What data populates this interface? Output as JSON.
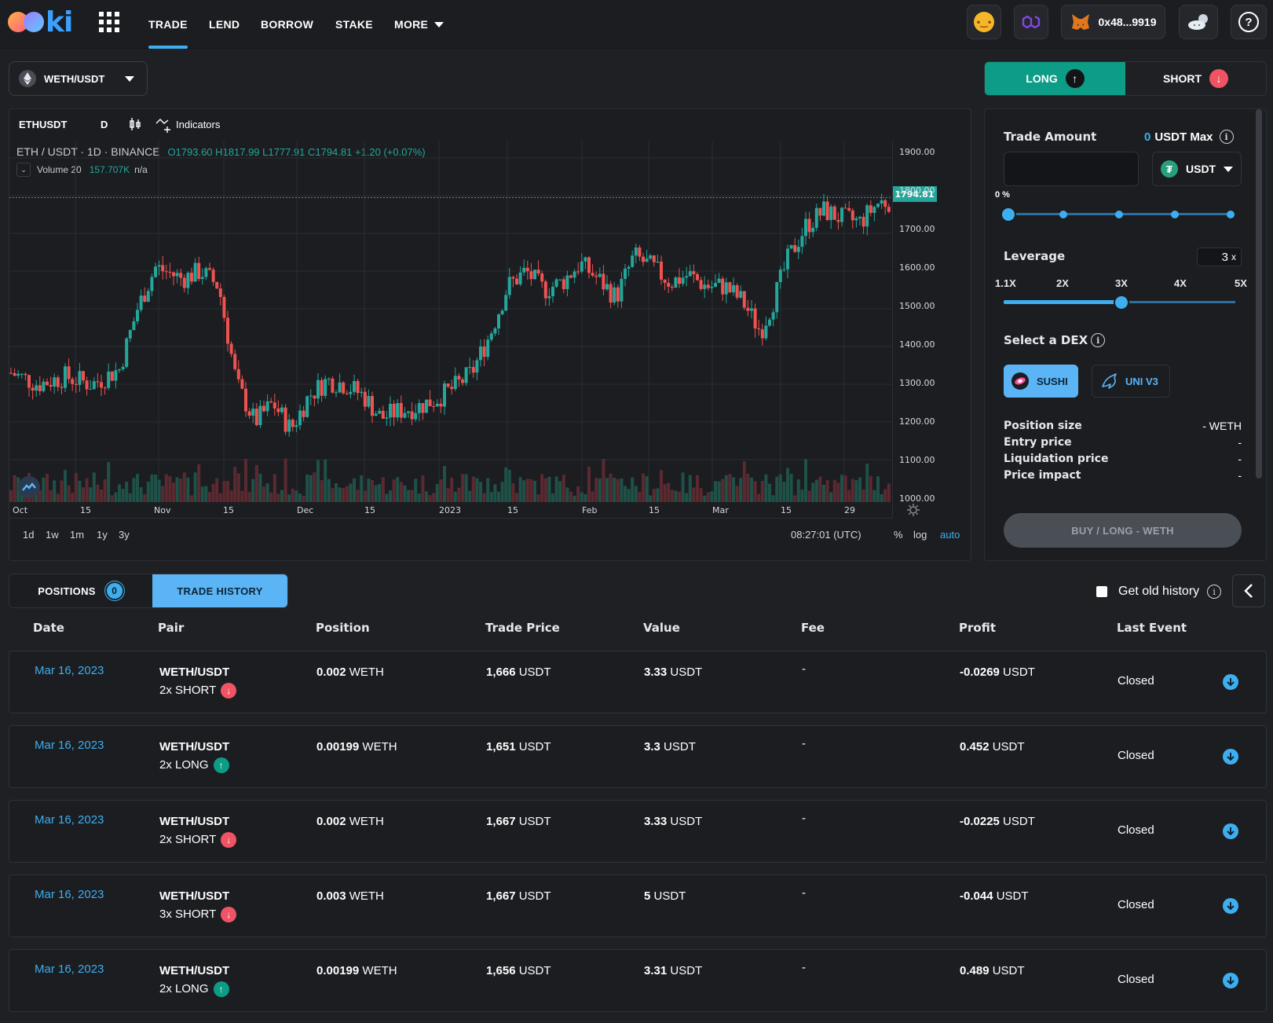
{
  "header": {
    "nav": [
      {
        "label": "TRADE",
        "active": true
      },
      {
        "label": "LEND",
        "active": false
      },
      {
        "label": "BORROW",
        "active": false
      },
      {
        "label": "STAKE",
        "active": false
      },
      {
        "label": "MORE",
        "active": false
      }
    ],
    "wallet_address": "0x48...9919"
  },
  "pair_selector": {
    "label": "WETH/USDT"
  },
  "chart": {
    "symbol": "ETHUSDT",
    "interval": "D",
    "indicators_label": "Indicators",
    "legend_title": "ETH / USDT · 1D · BINANCE",
    "ohlc": "O1793.60 H1817.99 L1777.91 C1794.81 +1.20 (+0.07%)",
    "volume_label": "Volume 20",
    "volume_value": "157.707K",
    "volume_na": "n/a",
    "last_price": "1794.81",
    "price_ticks": [
      "1900.00",
      "1800.00",
      "1700.00",
      "1600.00",
      "1500.00",
      "1400.00",
      "1300.00",
      "1200.00",
      "1100.00",
      "1000.00"
    ],
    "time_ticks": [
      "Oct",
      "15",
      "Nov",
      "15",
      "Dec",
      "15",
      "2023",
      "15",
      "Feb",
      "15",
      "Mar",
      "15",
      "29"
    ],
    "ranges": [
      "1d",
      "1w",
      "1m",
      "1y",
      "3y"
    ],
    "clock": "08:27:01 (UTC)",
    "percent_label": "%",
    "log_label": "log",
    "auto_label": "auto"
  },
  "chart_data": {
    "type": "candlestick",
    "ylim": [
      1000,
      1900
    ],
    "x_range": "Oct 2022 – Apr 2023",
    "last_close": 1794.81,
    "colors": {
      "up": "#26a69a",
      "down": "#ef5350"
    }
  },
  "side": {
    "long_label": "LONG",
    "short_label": "SHORT",
    "trade_amount_label": "Trade Amount",
    "max_value": "0",
    "max_text": "USDT Max",
    "token": "USDT",
    "percent": "0 %",
    "percent_fraction": 0,
    "leverage_label": "Leverage",
    "leverage_value": "3",
    "leverage_unit": "x",
    "leverage_steps": [
      "1.1X",
      "2X",
      "3X",
      "4X",
      "5X"
    ],
    "leverage_selected_fraction": 0.5,
    "dex_label": "Select a DEX",
    "dex_options": [
      "SUSHI",
      "UNI V3"
    ],
    "summary": [
      {
        "label": "Position size",
        "value": "- WETH"
      },
      {
        "label": "Entry price",
        "value": "-"
      },
      {
        "label": "Liquidation price",
        "value": "-"
      },
      {
        "label": "Price impact",
        "value": "-"
      }
    ],
    "buy_label": "BUY / LONG - WETH"
  },
  "bottom": {
    "positions_label": "POSITIONS",
    "positions_count": "0",
    "history_label": "TRADE HISTORY",
    "old_history_label": "Get old history"
  },
  "table": {
    "headers": [
      "Date",
      "Pair",
      "Position",
      "Trade Price",
      "Value",
      "Fee",
      "Profit",
      "Last Event"
    ],
    "rows": [
      {
        "date": "Mar 16, 2023",
        "pair": "WETH/USDT",
        "side": "2x SHORT",
        "dir": "short",
        "position": "0.002",
        "pos_unit": "WETH",
        "price": "1,666",
        "price_unit": "USDT",
        "value": "3.33",
        "value_unit": "USDT",
        "fee": "-",
        "profit": "-0.0269",
        "profit_unit": "USDT",
        "event": "Closed"
      },
      {
        "date": "Mar 16, 2023",
        "pair": "WETH/USDT",
        "side": "2x LONG",
        "dir": "long",
        "position": "0.00199",
        "pos_unit": "WETH",
        "price": "1,651",
        "price_unit": "USDT",
        "value": "3.3",
        "value_unit": "USDT",
        "fee": "-",
        "profit": "0.452",
        "profit_unit": "USDT",
        "event": "Closed"
      },
      {
        "date": "Mar 16, 2023",
        "pair": "WETH/USDT",
        "side": "2x SHORT",
        "dir": "short",
        "position": "0.002",
        "pos_unit": "WETH",
        "price": "1,667",
        "price_unit": "USDT",
        "value": "3.33",
        "value_unit": "USDT",
        "fee": "-",
        "profit": "-0.0225",
        "profit_unit": "USDT",
        "event": "Closed"
      },
      {
        "date": "Mar 16, 2023",
        "pair": "WETH/USDT",
        "side": "3x SHORT",
        "dir": "short",
        "position": "0.003",
        "pos_unit": "WETH",
        "price": "1,667",
        "price_unit": "USDT",
        "value": "5",
        "value_unit": "USDT",
        "fee": "-",
        "profit": "-0.044",
        "profit_unit": "USDT",
        "event": "Closed"
      },
      {
        "date": "Mar 16, 2023",
        "pair": "WETH/USDT",
        "side": "2x LONG",
        "dir": "long",
        "position": "0.00199",
        "pos_unit": "WETH",
        "price": "1,656",
        "price_unit": "USDT",
        "value": "3.31",
        "value_unit": "USDT",
        "fee": "-",
        "profit": "0.489",
        "profit_unit": "USDT",
        "event": "Closed"
      }
    ]
  }
}
